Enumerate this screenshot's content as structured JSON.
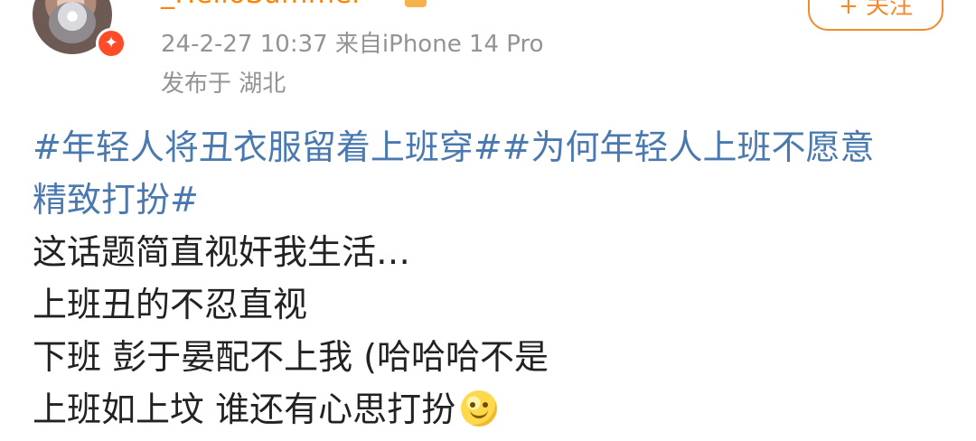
{
  "post": {
    "author": {
      "username": "_HelloSummer",
      "badge_icon": "verified-badge-icon",
      "badge_color": "#ff4c28"
    },
    "meta": {
      "time_device": "24-2-27 10:37  来自iPhone 14 Pro",
      "location": "发布于 湖北"
    },
    "actions": {
      "follow_label": "+ 关注"
    },
    "content": {
      "topic_line_1": "#年轻人将丑衣服留着上班穿##为何年轻人上班不愿意",
      "topic_line_2": "精致打扮#",
      "line_1": "这话题简直视奸我生活…",
      "line_2": "上班丑的不忍直视",
      "line_3": "下班 彭于晏配不上我 (哈哈哈不是",
      "line_4": "上班如上坟 谁还有心思打扮",
      "emoji": "smile-emoji"
    },
    "colors": {
      "username": "#ff8200",
      "topic": "#4a79b0",
      "meta": "#939393",
      "follow_border": "#f28a2e"
    }
  }
}
